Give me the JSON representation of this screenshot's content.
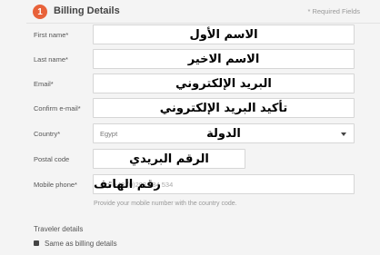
{
  "header": {
    "step_number": "1",
    "title": "Billing Details",
    "required_note": "* Required Fields"
  },
  "form": {
    "first_name": {
      "label": "First name*",
      "value": "الاسم الأول"
    },
    "last_name": {
      "label": "Last name*",
      "value": "الاسم الاخير"
    },
    "email": {
      "label": "Email*",
      "value": "البريد الإلكتروني"
    },
    "confirm_email": {
      "label": "Confirm e-mail*",
      "value": "تأكيد البريد الإلكتروني"
    },
    "country": {
      "label": "Country*",
      "selected": "Egypt",
      "value": "الدولة"
    },
    "postal_code": {
      "label": "Postal code",
      "value": "الرقم البريدي"
    },
    "mobile_phone": {
      "label": "Mobile phone*",
      "placeholder": "e.g. +43 (0)288 234 534",
      "value": "رقم الهاتف",
      "helper": "Provide your mobile number with the country code."
    }
  },
  "traveler": {
    "heading": "Traveler details",
    "same_as_billing_label": "Same as billing details",
    "same_as_billing_checked": true
  },
  "colors": {
    "accent": "#e8623a"
  }
}
